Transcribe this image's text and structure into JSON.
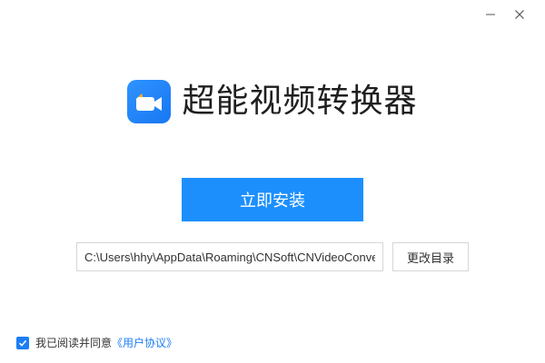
{
  "window": {
    "minimize_icon": "minimize-icon",
    "close_icon": "close-icon"
  },
  "brand": {
    "logo_icon": "video-camera-icon",
    "title": "超能视频转换器",
    "logo_color": "#1877f2"
  },
  "install": {
    "label": "立即安装",
    "color": "#1c8ffd"
  },
  "path": {
    "value": "C:\\Users\\hhy\\AppData\\Roaming\\CNSoft\\CNVideoConve",
    "change_label": "更改目录"
  },
  "agreement": {
    "checked": true,
    "text": "我已阅读并同意",
    "link": "《用户协议》",
    "link_color": "#1c7ef5"
  }
}
